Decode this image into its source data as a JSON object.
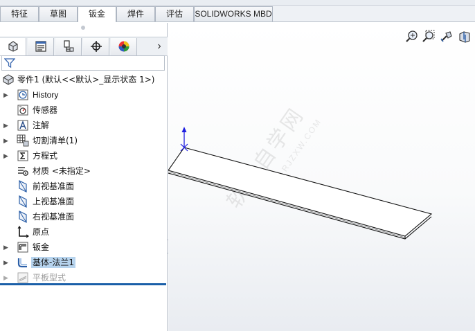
{
  "command_manager": {
    "tabs": [
      {
        "label": "特征",
        "active": false
      },
      {
        "label": "草图",
        "active": false
      },
      {
        "label": "钣金",
        "active": true
      },
      {
        "label": "焊件",
        "active": false
      },
      {
        "label": "评估",
        "active": false
      },
      {
        "label": "SOLIDWORKS MBD",
        "active": false
      }
    ]
  },
  "manager_tabs": [
    {
      "icon": "featuremanager-icon",
      "active": true
    },
    {
      "icon": "propertymanager-icon",
      "active": false
    },
    {
      "icon": "configurationmanager-icon",
      "active": false
    },
    {
      "icon": "dimxpert-icon",
      "active": false
    },
    {
      "icon": "displaymanager-icon",
      "active": false
    }
  ],
  "filter": {
    "icon": "filter-icon"
  },
  "feature_tree": {
    "root": {
      "label": "零件1  (默认<<默认>_显示状态 1>)",
      "icon": "part-icon"
    },
    "items": [
      {
        "label": "History",
        "icon": "history-icon",
        "expandable": true,
        "selected": false,
        "disabled": false
      },
      {
        "label": "传感器",
        "icon": "sensor-icon",
        "expandable": false,
        "selected": false,
        "disabled": false
      },
      {
        "label": "注解",
        "icon": "annotation-icon",
        "expandable": true,
        "selected": false,
        "disabled": false
      },
      {
        "label": "切割清单(1)",
        "icon": "cutlist-icon",
        "expandable": true,
        "selected": false,
        "disabled": false
      },
      {
        "label": "方程式",
        "icon": "equation-icon",
        "expandable": true,
        "selected": false,
        "disabled": false
      },
      {
        "label": "材质 <未指定>",
        "icon": "material-icon",
        "expandable": false,
        "selected": false,
        "disabled": false
      },
      {
        "label": "前视基准面",
        "icon": "plane-icon",
        "expandable": false,
        "selected": false,
        "disabled": false
      },
      {
        "label": "上视基准面",
        "icon": "plane-icon",
        "expandable": false,
        "selected": false,
        "disabled": false
      },
      {
        "label": "右视基准面",
        "icon": "plane-icon",
        "expandable": false,
        "selected": false,
        "disabled": false
      },
      {
        "label": "原点",
        "icon": "origin-icon",
        "expandable": false,
        "selected": false,
        "disabled": false
      },
      {
        "label": "钣金",
        "icon": "sheetmetal-icon",
        "expandable": true,
        "selected": false,
        "disabled": false
      },
      {
        "label": "基体-法兰1",
        "icon": "base-flange-icon",
        "expandable": true,
        "selected": true,
        "disabled": false
      },
      {
        "label": "平板型式",
        "icon": "flat-pattern-icon",
        "expandable": true,
        "selected": false,
        "disabled": true
      }
    ]
  },
  "heads_up_toolbar": [
    {
      "icon": "zoom-to-fit-icon"
    },
    {
      "icon": "zoom-to-area-icon"
    },
    {
      "icon": "previous-view-icon"
    },
    {
      "icon": "section-view-icon"
    }
  ],
  "watermark": {
    "text": "软件自学网",
    "subtext": "WWW.RJZXW.COM"
  },
  "colors": {
    "selection": "#b7d4ee",
    "rollback_bar": "#1a5fa8",
    "triad_y": "#1f1fe0"
  }
}
